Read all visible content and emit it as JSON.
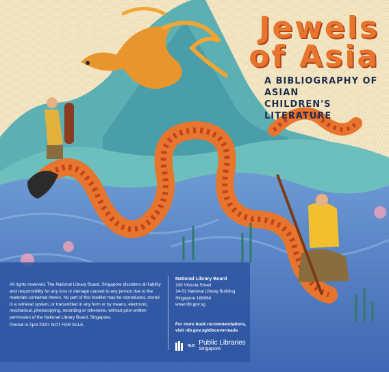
{
  "cover": {
    "title_line1": "Jewels",
    "title_line2": "of Asia",
    "subtitle_line1": "a bibliography of asian",
    "subtitle_line2": "children's literature"
  },
  "legal": {
    "text": "All rights reserved. The National Library Board, Singapore disclaims all liability and responsibility for any loss or damage caused to any person due to the materials contained herein. No part of this booklet may be reproduced, stored in a retrieval system, or transmitted in any form or by means, electronic, mechanical, photocopying, recording or otherwise, without prior written permission of the National Library Board, Singapore.",
    "printed": "Printed in April 2020. NOT FOR SALE."
  },
  "contact": {
    "org": "National Library Board",
    "address1": "100 Victoria Street",
    "address2": "14-01 National Library Building",
    "address3": "Singapore 188064",
    "website": "www.nlb.gov.sg",
    "recs_line1": "For more book recommendations,",
    "recs_line2": "visit nlb.gov.sg/discoverreads"
  },
  "logo": {
    "nlb": "NLB",
    "main": "Public Libraries",
    "sub": "Singapore"
  },
  "colors": {
    "sky": "#f3e6c4",
    "mountain": "#4aa7b0",
    "water": "#4d7cc6",
    "dragon": "#e8752d",
    "panel": "#2d54a0"
  }
}
